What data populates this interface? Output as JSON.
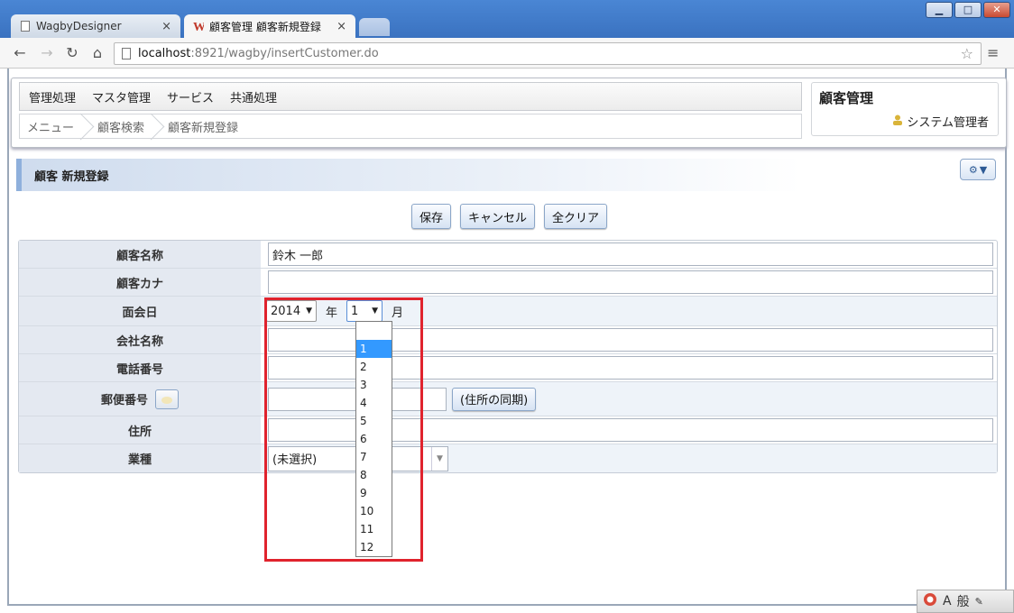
{
  "browser": {
    "tabs": [
      {
        "label": "WagbyDesigner",
        "close": "×"
      },
      {
        "label": "顧客管理 顧客新規登録",
        "close": "×"
      }
    ],
    "url_host": "localhost",
    "url_path": ":8921/wagby/insertCustomer.do"
  },
  "menu": {
    "items": [
      "管理処理",
      "マスタ管理",
      "サービス",
      "共通処理"
    ]
  },
  "breadcrumb": [
    "メニュー",
    "顧客検索",
    "顧客新規登録"
  ],
  "app": {
    "title": "顧客管理",
    "user": "システム管理者"
  },
  "form": {
    "title": "顧客 新規登録",
    "buttons": {
      "save": "保存",
      "cancel": "キャンセル",
      "clear": "全クリア"
    },
    "fields": {
      "customer_name": {
        "label": "顧客名称",
        "value": "鈴木 一郎"
      },
      "customer_kana": {
        "label": "顧客カナ",
        "value": ""
      },
      "meeting_date": {
        "label": "面会日",
        "year": "2014",
        "year_unit": "年",
        "month": "1",
        "month_unit": "月"
      },
      "company_name": {
        "label": "会社名称",
        "value": ""
      },
      "phone": {
        "label": "電話番号",
        "value": ""
      },
      "zip": {
        "label": "郵便番号",
        "value": "",
        "sync_button": "(住所の同期)"
      },
      "address": {
        "label": "住所",
        "value": ""
      },
      "industry": {
        "label": "業種",
        "value": "(未選択)"
      }
    },
    "month_options": [
      "",
      "1",
      "2",
      "3",
      "4",
      "5",
      "6",
      "7",
      "8",
      "9",
      "10",
      "11",
      "12"
    ],
    "selected_month_index": 1
  },
  "tray": {
    "ime_mode": "A",
    "ime_label": "般"
  },
  "colors": {
    "highlight": "#e0232d",
    "selected": "#3399ff",
    "accent": "#8fb0dc"
  }
}
